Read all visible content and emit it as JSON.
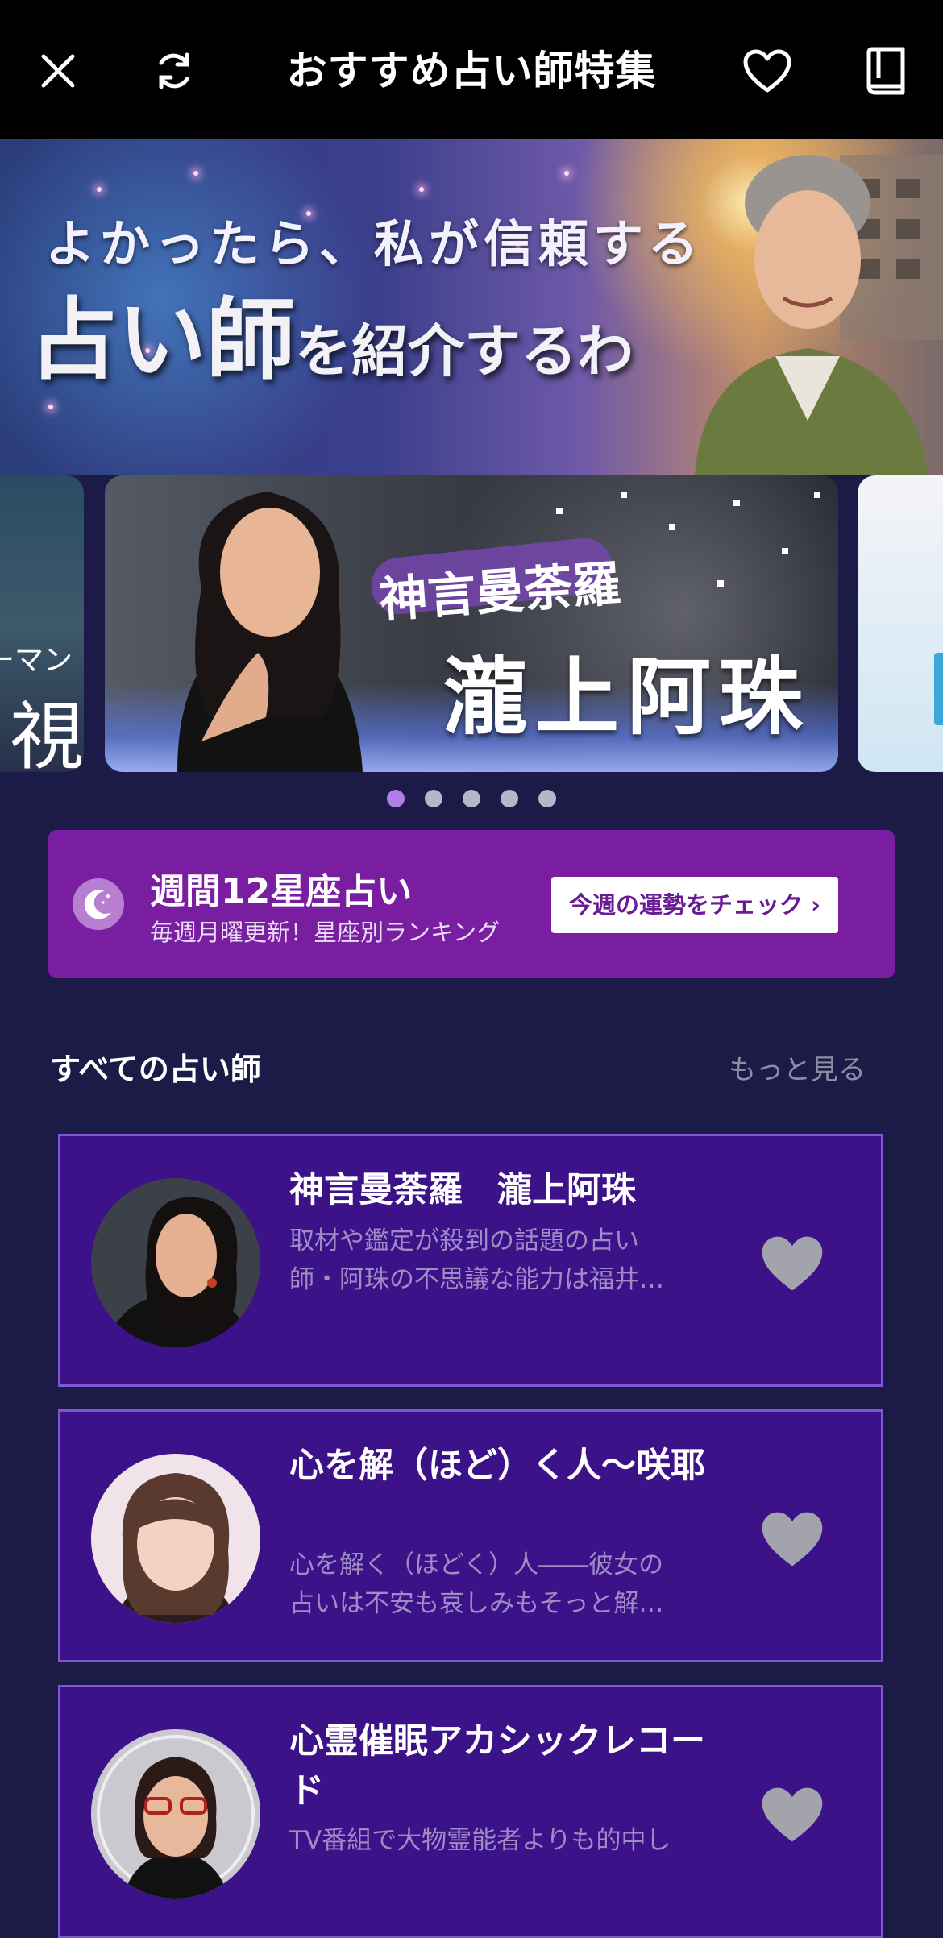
{
  "topbar": {
    "title": "おすすめ占い師特集",
    "icons": [
      "close-icon",
      "refresh-icon",
      "heart-icon",
      "book-icon"
    ]
  },
  "hero": {
    "line1": "よかったら、私が信頼する",
    "line2_big": "占い師",
    "line2_small": "を紹介するわ"
  },
  "carousel": {
    "left_slide": {
      "text_small": "ーマン",
      "text_big": "視"
    },
    "main_slide": {
      "subtitle": "神言曼荼羅",
      "name": "瀧上阿珠"
    },
    "page_count": 5,
    "active_index": 0
  },
  "promo": {
    "title": "週間12星座占い",
    "subtitle": "毎週月曜更新！星座別ランキング",
    "button": "今週の運勢をチェック ›"
  },
  "section": {
    "title": "すべての占い師",
    "more": "もっと見る"
  },
  "fortune_tellers": [
    {
      "name": "神言曼荼羅　瀧上阿珠",
      "desc_line1": "取材や鑑定が殺到の話題の占い",
      "desc_line2": "師・阿珠の不思議な能力は福井…"
    },
    {
      "name": "心を解（ほど）く人〜咲耶",
      "desc_line1": "心を解く（ほどく）人――彼女の",
      "desc_line2": "占いは不安も哀しみもそっと解…"
    },
    {
      "name": "心霊催眠アカシックレコード",
      "desc_line1": "TV番組で大物霊能者よりも的中し",
      "desc_line2": ""
    }
  ],
  "colors": {
    "background": "#1c1a47",
    "card": "#3c1289",
    "card_border": "#7f57d4",
    "promo": "#7a1ea1",
    "dot_active": "#b27de6",
    "heart": "#a3a3ab"
  }
}
